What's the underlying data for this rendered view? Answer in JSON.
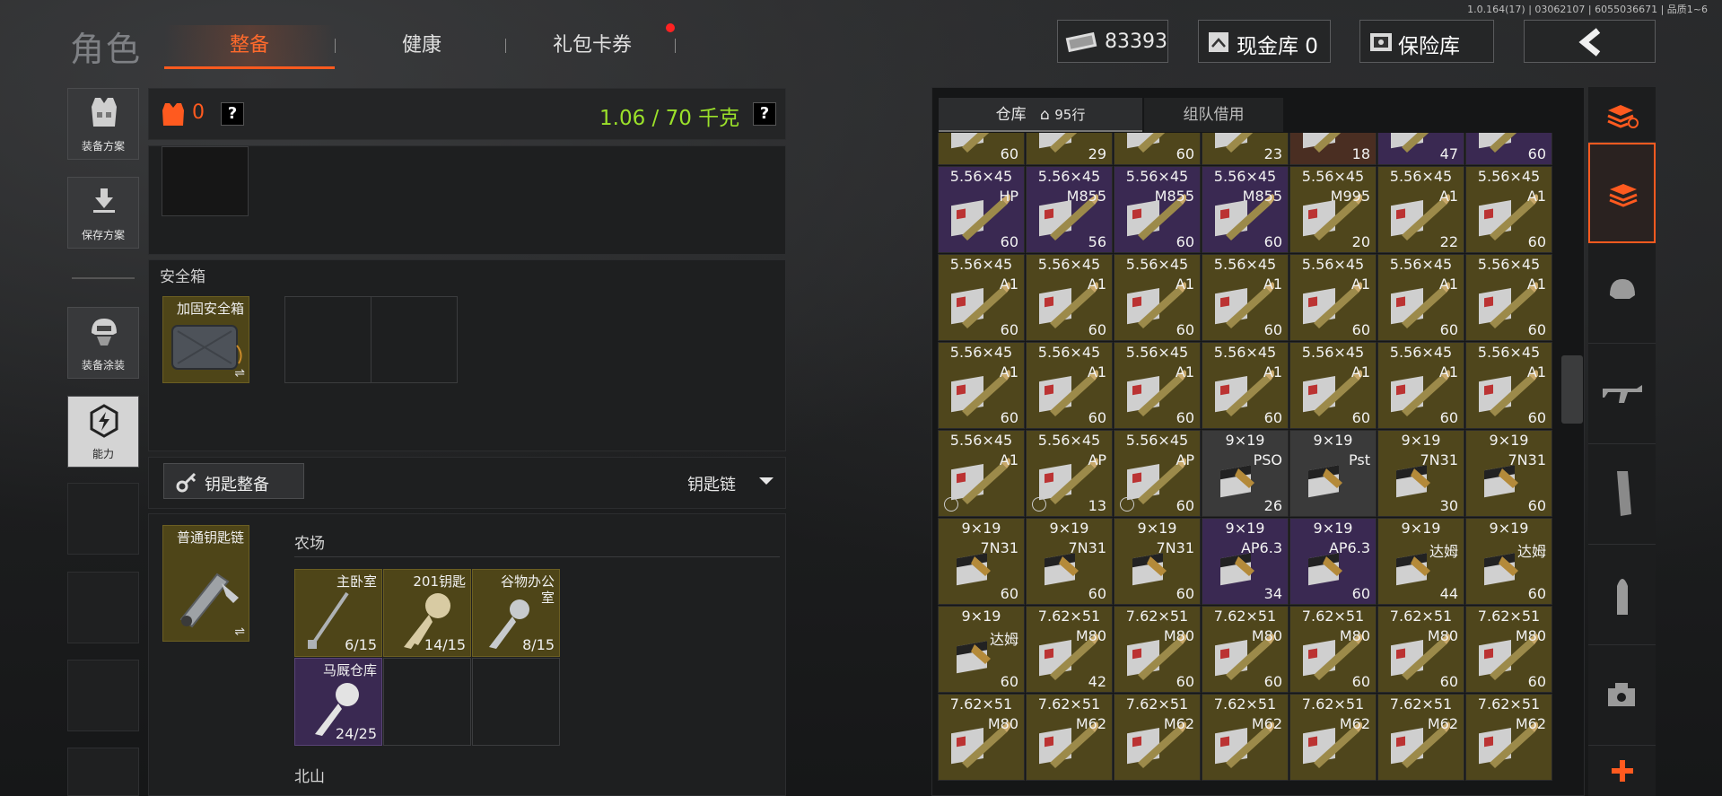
{
  "version": "1.0.164(17) | 03062107 | 6055036671 | 品质1~6",
  "header": {
    "title": "角色",
    "tabs": [
      "整备",
      "健康",
      "礼包卡券"
    ],
    "money": "83393",
    "cash_box": "现金库 0",
    "safe_box": "保险库"
  },
  "sidebar": {
    "items": [
      {
        "label": "装备方案",
        "icon": "vest-icon"
      },
      {
        "label": "保存方案",
        "icon": "download-icon"
      },
      {
        "label": "装备涂装",
        "icon": "helmet-icon"
      },
      {
        "label": "能力",
        "icon": "lightning-icon"
      }
    ]
  },
  "loadout": {
    "armor_count": "0",
    "help": "?",
    "weight": "1.06 / 70 千克",
    "weight_color": "#9be12a",
    "safe_section": "安全箱",
    "safe_item": "加固安全箱",
    "key_button": "钥匙整备",
    "key_dropdown": "钥匙链",
    "keychain_item": "普通钥匙链",
    "region_farm": "农场",
    "region_next": "北山",
    "keys": [
      {
        "name": "主卧室",
        "count": "6/15",
        "bg": "gold"
      },
      {
        "name": "201钥匙",
        "count": "14/15",
        "bg": "gold"
      },
      {
        "name": "谷物办公室",
        "count": "8/15",
        "bg": "gold"
      },
      {
        "name": "马厩仓库",
        "count": "24/25",
        "bg": "purple"
      }
    ]
  },
  "inventory": {
    "tab_warehouse": "仓库",
    "tab_rows": "95行",
    "tab_team": "组队借用",
    "rows": [
      [
        {
          "n": "",
          "v": "",
          "c": "60",
          "bg": "gold"
        },
        {
          "n": "",
          "v": "",
          "c": "29",
          "bg": "gold"
        },
        {
          "n": "",
          "v": "",
          "c": "60",
          "bg": "gold"
        },
        {
          "n": "",
          "v": "",
          "c": "23",
          "bg": "gold"
        },
        {
          "n": "",
          "v": "",
          "c": "18",
          "bg": "brown"
        },
        {
          "n": "",
          "v": "",
          "c": "47",
          "bg": "purple"
        },
        {
          "n": "",
          "v": "",
          "c": "60",
          "bg": "purple"
        }
      ],
      [
        {
          "n": "5.56×45",
          "v": "HP",
          "c": "60",
          "bg": "purple"
        },
        {
          "n": "5.56×45",
          "v": "M855",
          "c": "56",
          "bg": "purple"
        },
        {
          "n": "5.56×45",
          "v": "M855",
          "c": "60",
          "bg": "purple"
        },
        {
          "n": "5.56×45",
          "v": "M855",
          "c": "60",
          "bg": "purple"
        },
        {
          "n": "5.56×45",
          "v": "M995",
          "c": "20",
          "bg": "gold"
        },
        {
          "n": "5.56×45",
          "v": "A1",
          "c": "22",
          "bg": "gold"
        },
        {
          "n": "5.56×45",
          "v": "A1",
          "c": "60",
          "bg": "gold"
        }
      ],
      [
        {
          "n": "5.56×45",
          "v": "A1",
          "c": "60",
          "bg": "gold"
        },
        {
          "n": "5.56×45",
          "v": "A1",
          "c": "60",
          "bg": "gold"
        },
        {
          "n": "5.56×45",
          "v": "A1",
          "c": "60",
          "bg": "gold"
        },
        {
          "n": "5.56×45",
          "v": "A1",
          "c": "60",
          "bg": "gold"
        },
        {
          "n": "5.56×45",
          "v": "A1",
          "c": "60",
          "bg": "gold"
        },
        {
          "n": "5.56×45",
          "v": "A1",
          "c": "60",
          "bg": "gold"
        },
        {
          "n": "5.56×45",
          "v": "A1",
          "c": "60",
          "bg": "gold"
        }
      ],
      [
        {
          "n": "5.56×45",
          "v": "A1",
          "c": "60",
          "bg": "gold"
        },
        {
          "n": "5.56×45",
          "v": "A1",
          "c": "60",
          "bg": "gold"
        },
        {
          "n": "5.56×45",
          "v": "A1",
          "c": "60",
          "bg": "gold"
        },
        {
          "n": "5.56×45",
          "v": "A1",
          "c": "60",
          "bg": "gold"
        },
        {
          "n": "5.56×45",
          "v": "A1",
          "c": "60",
          "bg": "gold"
        },
        {
          "n": "5.56×45",
          "v": "A1",
          "c": "60",
          "bg": "gold"
        },
        {
          "n": "5.56×45",
          "v": "A1",
          "c": "60",
          "bg": "gold"
        }
      ],
      [
        {
          "n": "5.56×45",
          "v": "A1",
          "c": "",
          "bg": "gold",
          "badge": true
        },
        {
          "n": "5.56×45",
          "v": "AP",
          "c": "13",
          "bg": "gold",
          "badge": true
        },
        {
          "n": "5.56×45",
          "v": "AP",
          "c": "60",
          "bg": "gold",
          "badge": true
        },
        {
          "n": "9×19",
          "v": "PSO",
          "c": "26",
          "bg": "gray"
        },
        {
          "n": "9×19",
          "v": "Pst",
          "c": "",
          "bg": "gray"
        },
        {
          "n": "9×19",
          "v": "7N31",
          "c": "30",
          "bg": "gold"
        },
        {
          "n": "9×19",
          "v": "7N31",
          "c": "60",
          "bg": "gold"
        }
      ],
      [
        {
          "n": "9×19",
          "v": "7N31",
          "c": "60",
          "bg": "gold"
        },
        {
          "n": "9×19",
          "v": "7N31",
          "c": "60",
          "bg": "gold"
        },
        {
          "n": "9×19",
          "v": "7N31",
          "c": "60",
          "bg": "gold"
        },
        {
          "n": "9×19",
          "v": "AP6.3",
          "c": "34",
          "bg": "purple"
        },
        {
          "n": "9×19",
          "v": "AP6.3",
          "c": "60",
          "bg": "purple"
        },
        {
          "n": "9×19",
          "v": "达姆",
          "c": "44",
          "bg": "gold"
        },
        {
          "n": "9×19",
          "v": "达姆",
          "c": "60",
          "bg": "gold"
        }
      ],
      [
        {
          "n": "9×19",
          "v": "达姆",
          "c": "60",
          "bg": "gold"
        },
        {
          "n": "7.62×51",
          "v": "M80",
          "c": "42",
          "bg": "gold"
        },
        {
          "n": "7.62×51",
          "v": "M80",
          "c": "60",
          "bg": "gold"
        },
        {
          "n": "7.62×51",
          "v": "M80",
          "c": "60",
          "bg": "gold"
        },
        {
          "n": "7.62×51",
          "v": "M80",
          "c": "60",
          "bg": "gold"
        },
        {
          "n": "7.62×51",
          "v": "M80",
          "c": "60",
          "bg": "gold"
        },
        {
          "n": "7.62×51",
          "v": "M80",
          "c": "60",
          "bg": "gold"
        }
      ],
      [
        {
          "n": "7.62×51",
          "v": "M80",
          "c": "",
          "bg": "gold"
        },
        {
          "n": "7.62×51",
          "v": "M62",
          "c": "",
          "bg": "gold"
        },
        {
          "n": "7.62×51",
          "v": "M62",
          "c": "",
          "bg": "gold"
        },
        {
          "n": "7.62×51",
          "v": "M62",
          "c": "",
          "bg": "gold"
        },
        {
          "n": "7.62×51",
          "v": "M62",
          "c": "",
          "bg": "gold"
        },
        {
          "n": "7.62×51",
          "v": "M62",
          "c": "",
          "bg": "gold"
        },
        {
          "n": "7.62×51",
          "v": "M62",
          "c": "",
          "bg": "gold"
        }
      ]
    ]
  },
  "filters": [
    "all-icon",
    "armor-icon",
    "rifle-icon",
    "magazine-icon",
    "ammo-icon",
    "scope-icon",
    "add-icon"
  ],
  "colors": {
    "accent": "#ff5a1f",
    "weight_ok": "#9be12a"
  }
}
